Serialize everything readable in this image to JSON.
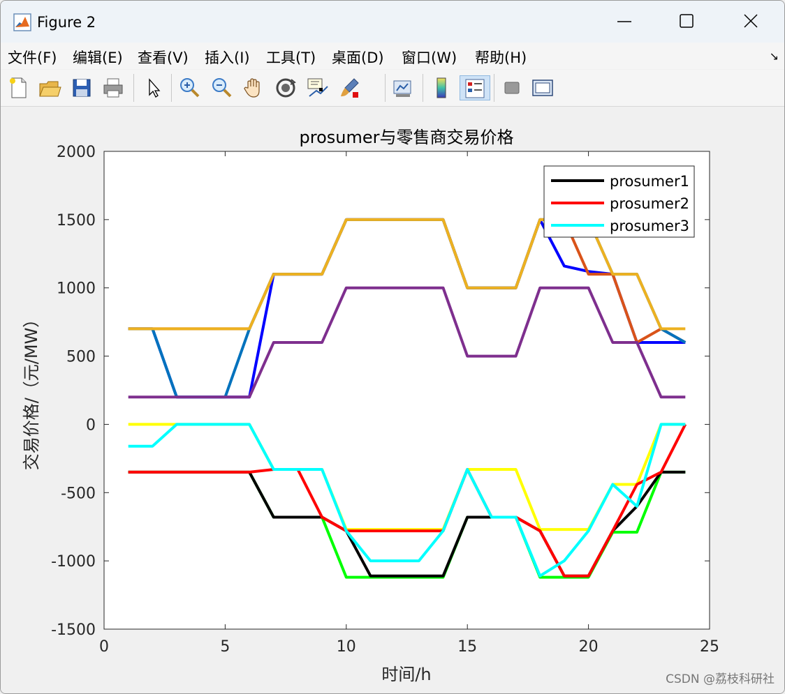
{
  "window": {
    "title": "Figure 2"
  },
  "menu": [
    "文件(F)",
    "编辑(E)",
    "查看(V)",
    "插入(I)",
    "工具(T)",
    "桌面(D)",
    "窗口(W)",
    "帮助(H)"
  ],
  "toolbar": {
    "icons": [
      "new-figure-icon",
      "open-file-icon",
      "save-icon",
      "print-icon",
      "edit-plot-arrow-icon",
      "zoom-in-icon",
      "zoom-out-icon",
      "pan-hand-icon",
      "rotate-3d-icon",
      "data-cursor-icon",
      "brush-icon",
      "link-plot-icon",
      "colorbar-icon",
      "legend-icon",
      "hide-plot-tools-icon",
      "show-plot-tools-icon"
    ]
  },
  "watermark": "CSDN @荔枝科研社",
  "chart_data": {
    "type": "line",
    "title": "prosumer与零售商交易价格",
    "xlabel": "时间/h",
    "ylabel": "交易价格/（元/MW）",
    "xlim": [
      0,
      25
    ],
    "ylim": [
      -1500,
      2000
    ],
    "xticks": [
      0,
      5,
      10,
      15,
      20,
      25
    ],
    "yticks": [
      2000,
      1500,
      1000,
      500,
      0,
      -500,
      -1000,
      -1500
    ],
    "grid": false,
    "legend_position": "top-right",
    "x": [
      1,
      2,
      3,
      4,
      5,
      6,
      7,
      8,
      9,
      10,
      11,
      12,
      13,
      14,
      15,
      16,
      17,
      18,
      19,
      20,
      21,
      22,
      23,
      24
    ],
    "series": [
      {
        "name": "prosumer1",
        "legend": true,
        "color": "#000000",
        "values": [
          -350,
          -350,
          -350,
          -350,
          -350,
          -350,
          -680,
          -680,
          -680,
          -780,
          -1110,
          -1110,
          -1110,
          -1110,
          -680,
          -680,
          -680,
          -780,
          -1110,
          -1110,
          -780,
          -600,
          -350,
          -350
        ]
      },
      {
        "name": "prosumer2",
        "legend": true,
        "color": "#ff0000",
        "values": [
          -350,
          -350,
          -350,
          -350,
          -350,
          -350,
          -330,
          -330,
          -680,
          -780,
          -780,
          -780,
          -780,
          -780,
          -330,
          -680,
          -680,
          -780,
          -1110,
          -1110,
          -780,
          -440,
          -350,
          0
        ]
      },
      {
        "name": "prosumer3",
        "legend": true,
        "color": "#00ffff",
        "values": [
          -160,
          -160,
          0,
          0,
          0,
          0,
          -330,
          -330,
          -330,
          -780,
          -1000,
          -1000,
          -1000,
          -780,
          -330,
          -680,
          -680,
          -1110,
          -1000,
          -780,
          -440,
          -600,
          0,
          0
        ]
      },
      {
        "legend": false,
        "color": "#0000ff",
        "values": [
          700,
          700,
          200,
          200,
          200,
          200,
          1100,
          1100,
          1100,
          1500,
          1500,
          1500,
          1500,
          1500,
          1000,
          1000,
          1000,
          1500,
          1160,
          1120,
          1100,
          600,
          600,
          600
        ]
      },
      {
        "legend": false,
        "color": "#d95319",
        "values": [
          700,
          700,
          700,
          700,
          700,
          700,
          1100,
          1100,
          1100,
          1500,
          1500,
          1500,
          1500,
          1500,
          1000,
          1000,
          1000,
          1500,
          1500,
          1100,
          1100,
          600,
          700,
          600
        ]
      },
      {
        "legend": false,
        "color": "#0072bd",
        "values": [
          700,
          700,
          200,
          200,
          200,
          700,
          1100,
          1100,
          1100,
          1500,
          1500,
          1500,
          1500,
          1500,
          1000,
          1000,
          1000,
          1500,
          1500,
          1500,
          1100,
          1100,
          700,
          600
        ]
      },
      {
        "legend": false,
        "color": "#00ff00",
        "values": [
          -350,
          -350,
          -350,
          -350,
          -350,
          -350,
          -680,
          -680,
          -680,
          -1120,
          -1120,
          -1120,
          -1120,
          -1120,
          -680,
          -680,
          -680,
          -1120,
          -1120,
          -1120,
          -790,
          -790,
          -350,
          -350
        ]
      },
      {
        "legend": false,
        "color": "#ffff00",
        "values": [
          0,
          0,
          0,
          0,
          0,
          0,
          -330,
          -330,
          -330,
          -770,
          -770,
          -770,
          -770,
          -770,
          -330,
          -330,
          -330,
          -770,
          -770,
          -770,
          -440,
          -440,
          0,
          0
        ]
      },
      {
        "legend": false,
        "color": "#edb120",
        "values": [
          700,
          700,
          700,
          700,
          700,
          700,
          1100,
          1100,
          1100,
          1500,
          1500,
          1500,
          1500,
          1500,
          1000,
          1000,
          1000,
          1500,
          1500,
          1500,
          1100,
          1100,
          700,
          700
        ]
      },
      {
        "legend": false,
        "color": "#7e2f8e",
        "values": [
          200,
          200,
          200,
          200,
          200,
          200,
          600,
          600,
          600,
          1000,
          1000,
          1000,
          1000,
          1000,
          500,
          500,
          500,
          1000,
          1000,
          1000,
          600,
          600,
          200,
          200
        ]
      }
    ]
  }
}
